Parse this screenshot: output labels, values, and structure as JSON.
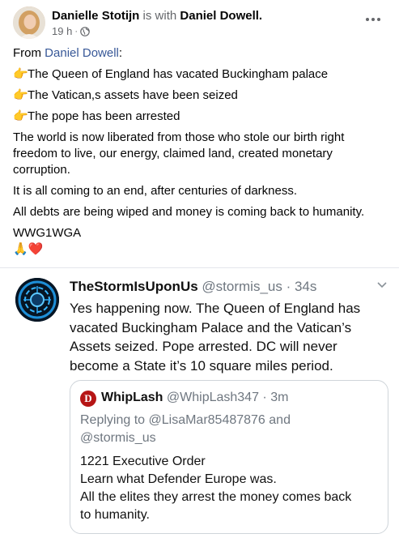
{
  "post": {
    "author": "Danielle Stotijn",
    "with_text": "is with",
    "tagged": "Daniel Dowell.",
    "time": "19 h",
    "separator": "·",
    "privacy_icon": "globe-icon",
    "more_icon": "more-horizontal-icon"
  },
  "body": {
    "from_label": "From",
    "from_link": "Daniel Dowell",
    "from_colon": ":",
    "points": [
      {
        "emoji": "👉",
        "text": "The Queen of England has vacated Buckingham palace"
      },
      {
        "emoji": "👉",
        "text": "The Vatican,s assets have been seized"
      },
      {
        "emoji": "👉",
        "text": "The pope has been arrested"
      }
    ],
    "para1": "The world is now liberated from those who stole our birth right freedom to live, our energy, claimed land, created monetary corruption.",
    "para2": "It is all coming to an end, after centuries of darkness.",
    "para3": "All debts are being wiped and money is coming back to humanity.",
    "tag": "WWG1WGA",
    "emojis": "🙏❤️"
  },
  "tweet": {
    "name": "TheStormIsUponUs",
    "handle": "@stormis_us · 34s",
    "text": "Yes happening now. The Queen of England has vacated Buckingham Palace and the Vatican’s Assets seized. Pope arrested. DC will never become a State it’s 10 square miles period.",
    "chevron_icon": "chevron-down-icon",
    "quote": {
      "avatar_letter": "D",
      "name": "WhipLash",
      "handle": "@WhipLash347 · 3m",
      "reply_line1": "Replying to @LisaMar85487876 and",
      "reply_line2": "@stormis_us",
      "lines": [
        "1221 Executive Order",
        "Learn what Defender Europe was.",
        "All the elites they arrest the money comes back",
        "to humanity."
      ]
    }
  }
}
